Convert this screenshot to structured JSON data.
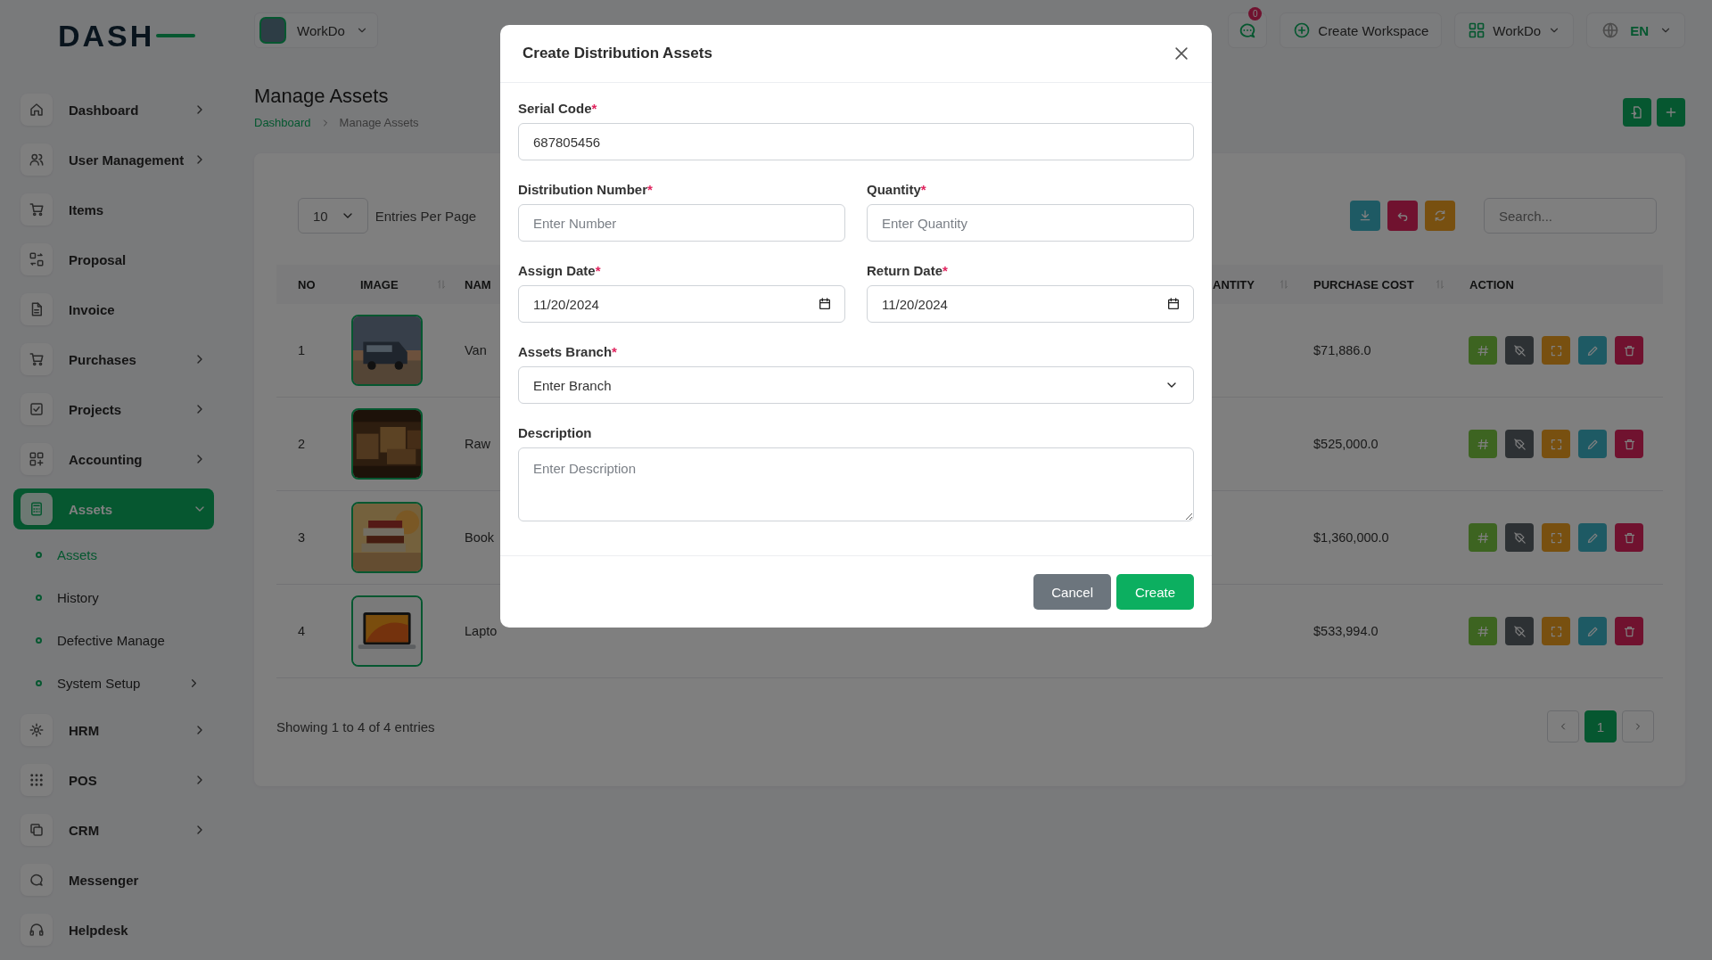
{
  "sidebar": {
    "logo": "DASH",
    "items": [
      {
        "label": "Dashboard",
        "submenu": true,
        "selected": false
      },
      {
        "label": "User Management",
        "submenu": true,
        "selected": false
      },
      {
        "label": "Items",
        "submenu": false,
        "selected": false
      },
      {
        "label": "Proposal",
        "submenu": false,
        "selected": false
      },
      {
        "label": "Invoice",
        "submenu": false,
        "selected": false
      },
      {
        "label": "Purchases",
        "submenu": true,
        "selected": false
      },
      {
        "label": "Projects",
        "submenu": true,
        "selected": false
      },
      {
        "label": "Accounting",
        "submenu": true,
        "selected": false
      },
      {
        "label": "Assets",
        "submenu": true,
        "selected": true,
        "expanded": true,
        "children": [
          {
            "label": "Assets",
            "selected": true,
            "submenu": false
          },
          {
            "label": "History",
            "selected": false,
            "submenu": false
          },
          {
            "label": "Defective Manage",
            "selected": false,
            "submenu": false
          },
          {
            "label": "System Setup",
            "selected": false,
            "submenu": true
          }
        ]
      },
      {
        "label": "HRM",
        "submenu": true,
        "selected": false
      },
      {
        "label": "POS",
        "submenu": true,
        "selected": false
      },
      {
        "label": "CRM",
        "submenu": true,
        "selected": false
      },
      {
        "label": "Messenger",
        "submenu": false,
        "selected": false
      },
      {
        "label": "Helpdesk",
        "submenu": false,
        "selected": false
      }
    ]
  },
  "header": {
    "workspace": "WorkDo",
    "notifications": "0",
    "create_workspace": "Create Workspace",
    "workspace_menu": "WorkDo",
    "language": "EN"
  },
  "page": {
    "title": "Manage Assets",
    "breadcrumb": [
      {
        "label": "Dashboard",
        "link": true
      },
      {
        "label": "Manage Assets",
        "link": false
      }
    ]
  },
  "table": {
    "entries": "10",
    "entries_label": "Entries Per Page",
    "search": {
      "placeholder": "Search..."
    },
    "columns": [
      {
        "label": "NO",
        "sortable": false
      },
      {
        "label": "IMAGE",
        "sortable": true
      },
      {
        "label": "NAM",
        "sortable": false
      },
      {
        "label": "ANTITY",
        "sortable": true
      },
      {
        "label": "PURCHASE COST",
        "sortable": true
      },
      {
        "label": "ACTION",
        "sortable": false
      }
    ],
    "rows": [
      {
        "no": "1",
        "name": "Van",
        "cost": "$71,886.0"
      },
      {
        "no": "2",
        "name": "Raw",
        "cost": "$525,000.0"
      },
      {
        "no": "3",
        "name": "Book",
        "cost": "$1,360,000.0"
      },
      {
        "no": "4",
        "name": "Lapto",
        "cost": "$533,994.0"
      }
    ],
    "footer": "Showing 1 to 4 of 4 entries",
    "pages": [
      {
        "label": "1",
        "selected": true
      }
    ]
  },
  "modal": {
    "title": "Create Distribution Assets",
    "fields": [
      {
        "label": "Serial Code",
        "required_mark": "*",
        "kind": "text",
        "wide": true,
        "value": "687805456"
      },
      {
        "label": "Distribution Number",
        "required_mark": "*",
        "kind": "text",
        "wide": false,
        "placeholder": "Enter Number"
      },
      {
        "label": "Quantity",
        "required_mark": "*",
        "kind": "text",
        "wide": false,
        "placeholder": "Enter Quantity"
      },
      {
        "label": "Assign Date",
        "required_mark": "*",
        "kind": "date",
        "wide": false,
        "value": "11/20/2024"
      },
      {
        "label": "Return Date",
        "required_mark": "*",
        "kind": "date",
        "wide": false,
        "value": "11/20/2024"
      },
      {
        "label": "Assets Branch",
        "required_mark": "*",
        "kind": "select",
        "wide": true,
        "value": "Enter Branch"
      },
      {
        "label": "Description",
        "kind": "textarea",
        "wide": true,
        "placeholder": "Enter Description"
      }
    ],
    "buttons": [
      {
        "label": "Cancel",
        "kind": "secondary"
      },
      {
        "label": "Create",
        "kind": "primary"
      }
    ]
  }
}
